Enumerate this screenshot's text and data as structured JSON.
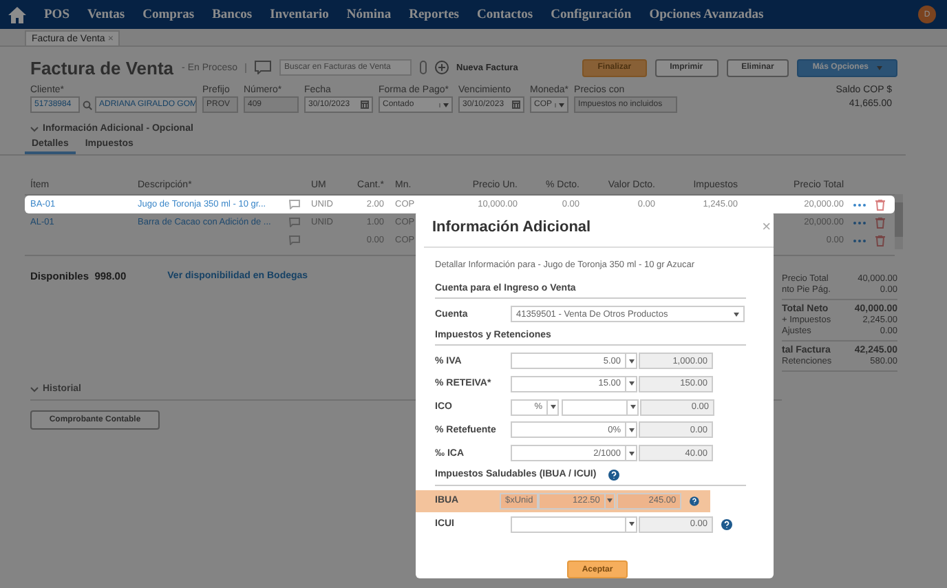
{
  "nav": {
    "items": [
      "POS",
      "Ventas",
      "Compras",
      "Bancos",
      "Inventario",
      "Nómina",
      "Reportes",
      "Contactos",
      "Configuración",
      "Opciones Avanzadas"
    ],
    "avatar": "D"
  },
  "doc_tabs": [
    {
      "label": "Factura de Venta",
      "close": "×",
      "selected": true
    }
  ],
  "header": {
    "title": "Factura de Venta",
    "status": "- En Proceso",
    "search": {
      "placeholder": "Buscar en Facturas de Venta"
    },
    "new_label": "Nueva Factura",
    "buttons": [
      {
        "label": "Finalizar",
        "kind": "warning"
      },
      {
        "label": "Imprimir",
        "kind": "default"
      },
      {
        "label": "Eliminar",
        "kind": "default"
      },
      {
        "label": "Más Opciones",
        "kind": "split"
      }
    ]
  },
  "form": {
    "fields": [
      {
        "label": "Cliente*",
        "kind": "client",
        "value": "51738984",
        "name": "ADRIANA GIRALDO GOM"
      },
      {
        "label": "Prefijo",
        "kind": "text",
        "value": "PROV"
      },
      {
        "label": "Número*",
        "kind": "text",
        "value": "409"
      },
      {
        "label": "Fecha",
        "kind": "date",
        "value": "30/10/2023"
      },
      {
        "label": "Forma de Pago*",
        "kind": "select",
        "value": "Contado"
      },
      {
        "label": "Vencimiento",
        "kind": "date",
        "value": "30/10/2023"
      },
      {
        "label": "Moneda*",
        "kind": "select",
        "value": "COP"
      },
      {
        "label": "Precios con",
        "kind": "text",
        "value": "Impuestos no incluidos"
      }
    ],
    "balance_label": "Saldo COP $",
    "balance": "41,665.00"
  },
  "extra_info": {
    "label": "Información Adicional - Opcional",
    "expanded": false
  },
  "detail_tabs": [
    {
      "label": "Detalles",
      "selected": true
    },
    {
      "label": "Impuestos",
      "selected": false
    }
  ],
  "table": {
    "columns": [
      "Ítem",
      "Descripción*",
      "UM",
      "Cant.*",
      "Mn.",
      "Precio Un.",
      "% Dcto.",
      "Valor Dcto.",
      "Impuestos",
      "Precio Total"
    ],
    "rows": [
      {
        "selected": true,
        "cells": [
          "BA-01",
          "Jugo de Toronja 350 ml - 10 gr...",
          "UNID",
          "2.00",
          "COP",
          "10,000.00",
          "0.00",
          "0.00",
          "1,245.00",
          "20,000.00"
        ]
      },
      {
        "selected": false,
        "cells": [
          "AL-01",
          "Barra de Cacao con Adición de ...",
          "UNID",
          "1.00",
          "COP",
          null,
          null,
          null,
          null,
          "20,000.00"
        ]
      },
      {
        "selected": false,
        "cells": [
          null,
          null,
          null,
          "0.00",
          "COP",
          null,
          null,
          null,
          null,
          "0.00"
        ]
      }
    ]
  },
  "available": {
    "label": "Disponibles",
    "value": "998.00",
    "link": "Ver disponibilidad en Bodegas"
  },
  "totals": [
    {
      "rows": [
        {
          "label": "Precio Total",
          "value": "40,000.00",
          "strong": false
        },
        {
          "label": "nto Pie Pág.",
          "value": "0.00",
          "strong": false
        }
      ]
    },
    {
      "rows": [
        {
          "label": "Total Neto",
          "value": "40,000.00",
          "strong": true
        },
        {
          "label": "+ Impuestos",
          "value": "2,245.00",
          "strong": false
        },
        {
          "label": "Ajustes",
          "value": "0.00",
          "strong": false
        }
      ]
    },
    {
      "rows": [
        {
          "label": "tal Factura",
          "value": "42,245.00",
          "strong": true
        },
        {
          "label": "Retenciones",
          "value": "580.00",
          "strong": false
        }
      ]
    }
  ],
  "history": {
    "label": "Historial",
    "expanded": false,
    "button": "Comprobante Contable"
  },
  "modal": {
    "title": "Información Adicional",
    "close": "×",
    "description": "Detallar Información para - Jugo de Toronja 350 ml - 10 gr Azucar",
    "account_section": "Cuenta para el Ingreso o Venta",
    "account_label": "Cuenta",
    "account_value": "41359501 - Venta De Otros Productos",
    "tax_section": "Impuestos y Retenciones",
    "taxes": [
      {
        "kind": "plain",
        "label": "% IVA",
        "value": "5.00",
        "result": "1,000.00",
        "highlighted": false,
        "help": false
      },
      {
        "kind": "plain",
        "label": "% RETEIVA*",
        "value": "15.00",
        "result": "150.00",
        "highlighted": false,
        "help": false
      },
      {
        "kind": "unit",
        "label": "ICO",
        "unit": "%",
        "unit_select": true,
        "result": "0.00",
        "highlighted": false,
        "help": false
      },
      {
        "kind": "plain",
        "label": "% Retefuente",
        "value": "0%",
        "result": "0.00",
        "highlighted": false,
        "help": false
      },
      {
        "kind": "plain",
        "label": "‰ ICA",
        "value": "2/1000",
        "result": "40.00",
        "highlighted": false,
        "help": false
      }
    ],
    "health_section": "Impuestos Saludables (IBUA / ICUI)",
    "health": [
      {
        "kind": "unit",
        "label": "IBUA",
        "unit": "$xUnid",
        "unit_select": false,
        "value": "122.50",
        "result": "245.00",
        "highlighted": true,
        "help": true
      },
      {
        "kind": "plain",
        "label": "ICUI",
        "result": "0.00",
        "highlighted": false,
        "help": true
      }
    ],
    "accept": "Aceptar"
  }
}
